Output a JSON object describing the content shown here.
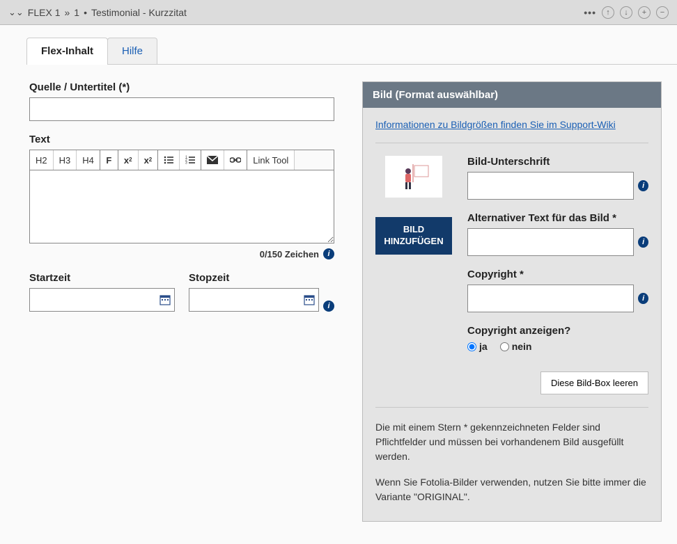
{
  "topbar": {
    "breadcrumb_root": "FLEX 1",
    "breadcrumb_sep1": "»",
    "breadcrumb_item": "1",
    "breadcrumb_dot": "•",
    "breadcrumb_title": "Testimonial - Kurzzitat"
  },
  "tabs": {
    "content": "Flex-Inhalt",
    "help": "Hilfe"
  },
  "left": {
    "source_label": "Quelle / Untertitel (*)",
    "source_value": "",
    "text_label": "Text",
    "toolbar": {
      "h2": "H2",
      "h3": "H3",
      "h4": "H4",
      "bold": "F",
      "sup": "x",
      "sup_exp": "2",
      "sub": "x",
      "sub_exp": "2",
      "link_tool": "Link Tool"
    },
    "text_value": "",
    "counter": "0/150 Zeichen",
    "start_label": "Startzeit",
    "start_value": "",
    "stop_label": "Stopzeit",
    "stop_value": ""
  },
  "right": {
    "header": "Bild (Format auswählbar)",
    "info_link": "Informationen zu Bildgrößen finden Sie im Support-Wiki",
    "add_image_line1": "BILD",
    "add_image_line2": "HINZUFÜGEN",
    "caption_label": "Bild-Unterschrift",
    "caption_value": "",
    "alt_label": "Alternativer Text für das Bild *",
    "alt_value": "",
    "copyright_label": "Copyright *",
    "copyright_value": "",
    "show_copyright_label": "Copyright anzeigen?",
    "radio_yes": "ja",
    "radio_no": "nein",
    "clear_button": "Diese Bild-Box leeren",
    "note1": "Die mit einem Stern * gekennzeichneten Felder sind Pflichtfelder und müssen bei vorhandenem Bild ausgefüllt werden.",
    "note2": "Wenn Sie Fotolia-Bilder verwenden, nutzen Sie bitte immer die Variante \"ORIGINAL\"."
  }
}
